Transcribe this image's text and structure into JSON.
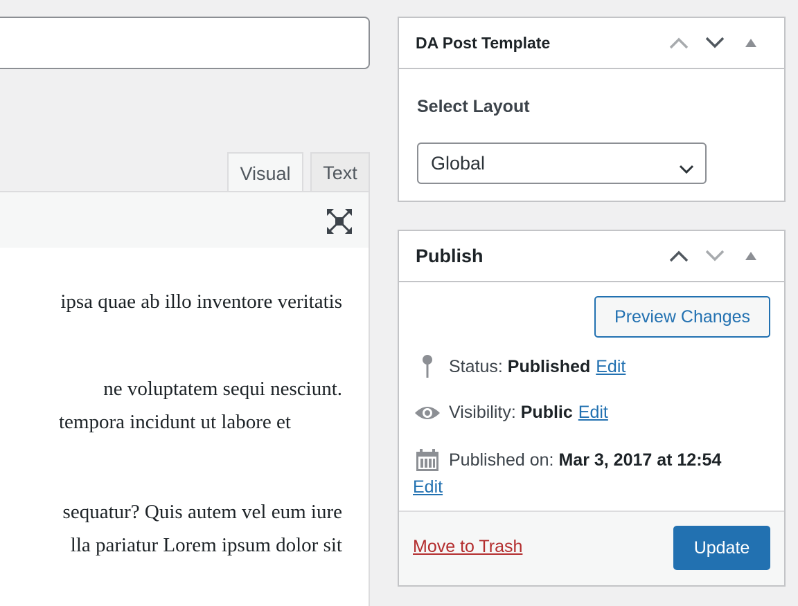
{
  "editor": {
    "tabs": [
      {
        "label": "Visual"
      },
      {
        "label": "Text"
      }
    ],
    "content_lines": [
      "ipsa quae ab illo inventore veritatis",
      "ne voluptatem sequi nesciunt.",
      "tempora incidunt ut labore et",
      "sequatur? Quis autem vel eum iure",
      "lla pariatur Lorem ipsum dolor sit"
    ]
  },
  "template_box": {
    "title": "DA Post Template",
    "select_label": "Select Layout",
    "select_value": "Global"
  },
  "publish_box": {
    "title": "Publish",
    "preview_label": "Preview Changes",
    "status_label": "Status:",
    "status_value": "Published",
    "visibility_label": "Visibility:",
    "visibility_value": "Public",
    "published_label": "Published on:",
    "published_value": "Mar 3, 2017 at 12:54",
    "edit_label": "Edit",
    "trash_label": "Move to Trash",
    "update_label": "Update"
  },
  "colors": {
    "accent": "#2271b1",
    "danger": "#b32d2e",
    "border": "#c3c4c7",
    "background": "#f0f0f1"
  },
  "icons": {
    "move_up": "chevron-up-icon",
    "move_down": "chevron-down-icon",
    "toggle": "triangle-up-icon",
    "fullscreen": "fullscreen-icon",
    "status": "pin-icon",
    "visibility": "eye-icon",
    "calendar": "calendar-icon"
  }
}
